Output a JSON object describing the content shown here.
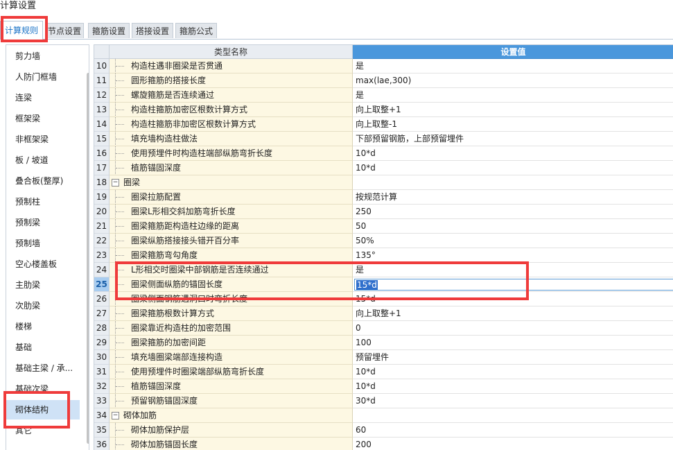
{
  "window": {
    "title": "计算设置"
  },
  "tabs": [
    {
      "label": "计算规则",
      "active": true
    },
    {
      "label": "节点设置",
      "active": false
    },
    {
      "label": "箍筋设置",
      "active": false
    },
    {
      "label": "搭接设置",
      "active": false
    },
    {
      "label": "箍筋公式",
      "active": false
    }
  ],
  "sidebar": {
    "items": [
      {
        "label": "剪力墙"
      },
      {
        "label": "人防门框墙"
      },
      {
        "label": "连梁"
      },
      {
        "label": "框架梁"
      },
      {
        "label": "非框架梁"
      },
      {
        "label": "板 / 坡道"
      },
      {
        "label": "叠合板(整厚)"
      },
      {
        "label": "预制柱"
      },
      {
        "label": "预制梁"
      },
      {
        "label": "预制墙"
      },
      {
        "label": "空心楼盖板"
      },
      {
        "label": "主肋梁"
      },
      {
        "label": "次肋梁"
      },
      {
        "label": "楼梯"
      },
      {
        "label": "基础"
      },
      {
        "label": "基础主梁 / 承..."
      },
      {
        "label": "基础次梁"
      },
      {
        "label": "砌体结构",
        "selected": true
      },
      {
        "label": "其它"
      }
    ]
  },
  "grid": {
    "headers": {
      "name": "类型名称",
      "value": "设置值"
    },
    "rows": [
      {
        "num": "10",
        "name": "构造柱遇非圈梁是否贯通",
        "value": "是"
      },
      {
        "num": "11",
        "name": "圆形箍筋的搭接长度",
        "value": "max(lae,300)"
      },
      {
        "num": "12",
        "name": "螺旋箍筋是否连续通过",
        "value": "是"
      },
      {
        "num": "13",
        "name": "构造柱箍筋加密区根数计算方式",
        "value": "向上取整+1"
      },
      {
        "num": "14",
        "name": "构造柱箍筋非加密区根数计算方式",
        "value": "向上取整-1"
      },
      {
        "num": "15",
        "name": "填充墙构造柱做法",
        "value": "下部预留钢筋，上部预留埋件"
      },
      {
        "num": "16",
        "name": "使用预埋件时构造柱端部纵筋弯折长度",
        "value": "10*d"
      },
      {
        "num": "17",
        "name": "植筋锚固深度",
        "value": "10*d"
      },
      {
        "num": "18",
        "name": "圈梁",
        "value": "",
        "group": true,
        "toggle": "−"
      },
      {
        "num": "19",
        "name": "圈梁拉筋配置",
        "value": "按规范计算"
      },
      {
        "num": "20",
        "name": "圈梁L形相交斜加筋弯折长度",
        "value": "250"
      },
      {
        "num": "21",
        "name": "圈梁箍筋距构造柱边缘的距离",
        "value": "50"
      },
      {
        "num": "22",
        "name": "圈梁纵筋搭接接头错开百分率",
        "value": "50%"
      },
      {
        "num": "23",
        "name": "圈梁箍筋弯勾角度",
        "value": "135°"
      },
      {
        "num": "24",
        "name": "L形相交时圈梁中部钢筋是否连续通过",
        "value": "是"
      },
      {
        "num": "25",
        "name": "圈梁侧面纵筋的锚固长度",
        "value": "15*d",
        "current": true
      },
      {
        "num": "26",
        "name": "圈梁侧面钢筋遇洞口时弯折长度",
        "value": "15*d"
      },
      {
        "num": "27",
        "name": "圈梁箍筋根数计算方式",
        "value": "向上取整+1"
      },
      {
        "num": "28",
        "name": "圈梁靠近构造柱的加密范围",
        "value": "0"
      },
      {
        "num": "29",
        "name": "圈梁箍筋的加密间距",
        "value": "100"
      },
      {
        "num": "30",
        "name": "填充墙圈梁端部连接构造",
        "value": "预留埋件"
      },
      {
        "num": "31",
        "name": "使用预埋件时圈梁端部纵筋弯折长度",
        "value": "10*d"
      },
      {
        "num": "32",
        "name": "植筋锚固深度",
        "value": "10*d"
      },
      {
        "num": "33",
        "name": "预留钢筋锚固深度",
        "value": "30*d"
      },
      {
        "num": "34",
        "name": "砌体加筋",
        "value": "",
        "group": true,
        "toggle": "−"
      },
      {
        "num": "35",
        "name": "砌体加筋保护层",
        "value": "60"
      },
      {
        "num": "36",
        "name": "砌体加筋锚固长度",
        "value": "200"
      }
    ]
  },
  "colors": {
    "highlight": "#ef3b3b",
    "header_selected": "#4a97dc",
    "name_cell_bg": "#fdf8e3",
    "selected_item_bg": "#cfe2f6"
  }
}
